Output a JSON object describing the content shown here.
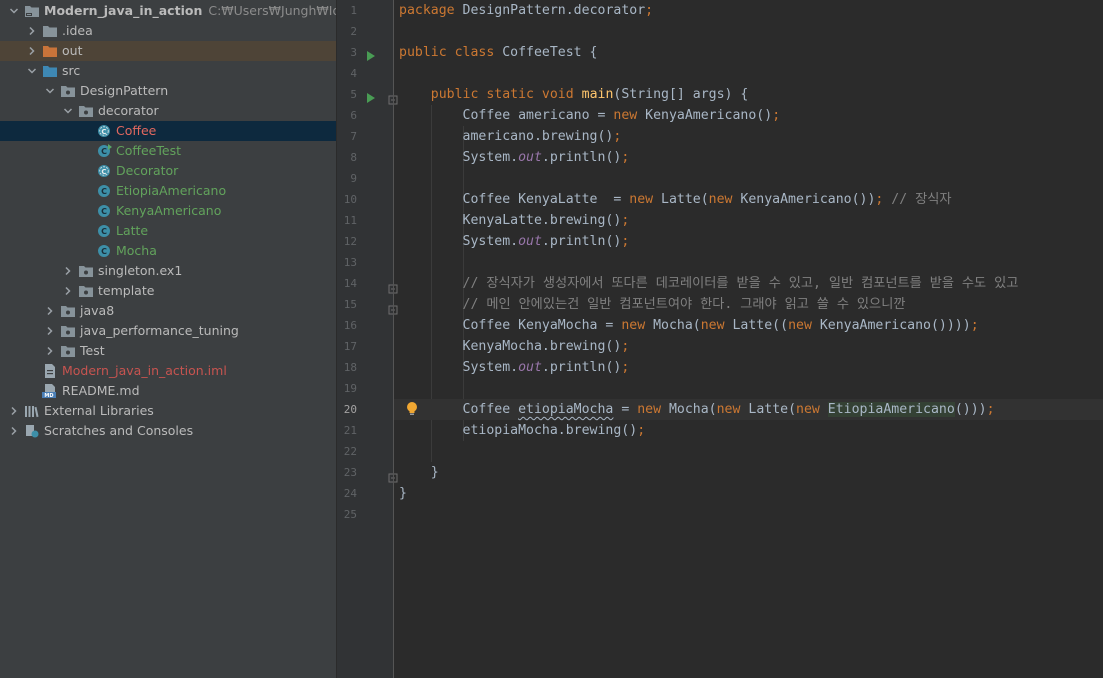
{
  "project": {
    "rows": [
      {
        "label": "Modern_java_in_action",
        "path": "C:₩Users₩Jungh₩IdeaProje",
        "icon": "project-folder-icon",
        "arrow": "down",
        "indent": 0,
        "style": "bold"
      },
      {
        "label": ".idea",
        "icon": "folder-icon",
        "arrow": "right",
        "indent": 1
      },
      {
        "label": "out",
        "icon": "orange-folder-icon",
        "arrow": "right",
        "indent": 1,
        "rowbg": "out"
      },
      {
        "label": "src",
        "icon": "source-folder-icon",
        "arrow": "down",
        "indent": 1
      },
      {
        "label": "DesignPattern",
        "icon": "package-icon",
        "arrow": "down",
        "indent": 2
      },
      {
        "label": "decorator",
        "icon": "package-icon",
        "arrow": "down",
        "indent": 3
      },
      {
        "label": "Coffee",
        "icon": "abstract-class-icon",
        "indent": 4,
        "color": "red2",
        "selected": true
      },
      {
        "label": "CoffeeTest",
        "icon": "runnable-class-icon",
        "indent": 4,
        "color": "green"
      },
      {
        "label": "Decorator",
        "icon": "abstract-class-icon",
        "indent": 4,
        "color": "green"
      },
      {
        "label": "EtiopiaAmericano",
        "icon": "class-icon",
        "indent": 4,
        "color": "green"
      },
      {
        "label": "KenyaAmericano",
        "icon": "class-icon",
        "indent": 4,
        "color": "green"
      },
      {
        "label": "Latte",
        "icon": "class-icon",
        "indent": 4,
        "color": "green"
      },
      {
        "label": "Mocha",
        "icon": "class-icon",
        "indent": 4,
        "color": "green"
      },
      {
        "label": "singleton.ex1",
        "icon": "package-icon",
        "arrow": "right",
        "indent": 3
      },
      {
        "label": "template",
        "icon": "package-icon",
        "arrow": "right",
        "indent": 3
      },
      {
        "label": "java8",
        "icon": "package-icon",
        "arrow": "right",
        "indent": 2
      },
      {
        "label": "java_performance_tuning",
        "icon": "package-icon",
        "arrow": "right",
        "indent": 2
      },
      {
        "label": "Test",
        "icon": "package-icon",
        "arrow": "right",
        "indent": 2
      },
      {
        "label": "Modern_java_in_action.iml",
        "icon": "iml-file-icon",
        "indent": 1,
        "color": "red"
      },
      {
        "label": "README.md",
        "icon": "markdown-file-icon",
        "indent": 1
      },
      {
        "label": "External Libraries",
        "icon": "library-icon",
        "arrow": "right",
        "indent": 0
      },
      {
        "label": "Scratches and Consoles",
        "icon": "scratches-icon",
        "arrow": "right",
        "indent": 0
      }
    ]
  },
  "editor": {
    "current_line": 20,
    "lines": [
      {
        "n": 1,
        "tokens": [
          [
            "kw",
            "package "
          ],
          [
            "",
            "DesignPattern.decorator"
          ],
          [
            "kw",
            ";"
          ]
        ]
      },
      {
        "n": 2,
        "tokens": []
      },
      {
        "n": 3,
        "run": true,
        "tokens": [
          [
            "kw",
            "public class "
          ],
          [
            "",
            "CoffeeTest {"
          ]
        ]
      },
      {
        "n": 4,
        "tokens": []
      },
      {
        "n": 5,
        "run": true,
        "fold": true,
        "tokens": [
          [
            "",
            "    "
          ],
          [
            "kw",
            "public static void "
          ],
          [
            "fn",
            "main"
          ],
          [
            "",
            "(String[] args) {"
          ]
        ]
      },
      {
        "n": 6,
        "tokens": [
          [
            "",
            "        Coffee americano = "
          ],
          [
            "kw",
            "new "
          ],
          [
            "",
            "KenyaAmericano()"
          ],
          [
            "kw",
            ";"
          ]
        ]
      },
      {
        "n": 7,
        "tokens": [
          [
            "",
            "        americano.brewing()"
          ],
          [
            "kw",
            ";"
          ]
        ]
      },
      {
        "n": 8,
        "tokens": [
          [
            "",
            "        System."
          ],
          [
            "st",
            "out"
          ],
          [
            "",
            ".println()"
          ],
          [
            "kw",
            ";"
          ]
        ]
      },
      {
        "n": 9,
        "tokens": []
      },
      {
        "n": 10,
        "tokens": [
          [
            "",
            "        Coffee KenyaLatte  = "
          ],
          [
            "kw",
            "new "
          ],
          [
            "",
            "Latte("
          ],
          [
            "kw",
            "new "
          ],
          [
            "",
            "KenyaAmericano())"
          ],
          [
            "kw",
            "; "
          ],
          [
            "cm",
            "// 장식자"
          ]
        ]
      },
      {
        "n": 11,
        "tokens": [
          [
            "",
            "        KenyaLatte.brewing()"
          ],
          [
            "kw",
            ";"
          ]
        ]
      },
      {
        "n": 12,
        "tokens": [
          [
            "",
            "        System."
          ],
          [
            "st",
            "out"
          ],
          [
            "",
            ".println()"
          ],
          [
            "kw",
            ";"
          ]
        ]
      },
      {
        "n": 13,
        "tokens": []
      },
      {
        "n": 14,
        "fold": true,
        "tokens": [
          [
            "",
            "        "
          ],
          [
            "cm",
            "// 장식자가 생성자에서 또다른 데코레이터를 받을 수 있고, 일반 컴포넌트를 받을 수도 있고"
          ]
        ]
      },
      {
        "n": 15,
        "fold": true,
        "tokens": [
          [
            "",
            "        "
          ],
          [
            "cm",
            "// 메인 안에있는건 일반 컴포넌트여야 한다. 그래야 읽고 쓸 수 있으니깐"
          ]
        ]
      },
      {
        "n": 16,
        "tokens": [
          [
            "",
            "        Coffee KenyaMocha = "
          ],
          [
            "kw",
            "new "
          ],
          [
            "",
            "Mocha("
          ],
          [
            "kw",
            "new "
          ],
          [
            "",
            "Latte(("
          ],
          [
            "kw",
            "new "
          ],
          [
            "",
            "KenyaAmericano())))"
          ],
          [
            "kw",
            ";"
          ]
        ]
      },
      {
        "n": 17,
        "tokens": [
          [
            "",
            "        KenyaMocha.brewing()"
          ],
          [
            "kw",
            ";"
          ]
        ]
      },
      {
        "n": 18,
        "tokens": [
          [
            "",
            "        System."
          ],
          [
            "st",
            "out"
          ],
          [
            "",
            ".println()"
          ],
          [
            "kw",
            ";"
          ]
        ]
      },
      {
        "n": 19,
        "tokens": []
      },
      {
        "n": 20,
        "bulb": true,
        "tokens": [
          [
            "",
            "        Coffee "
          ],
          [
            "wavy",
            "etiopiaMocha"
          ],
          [
            "",
            " = "
          ],
          [
            "kw",
            "new "
          ],
          [
            "",
            "Mocha("
          ],
          [
            "kw",
            "new "
          ],
          [
            "",
            "Latte("
          ],
          [
            "kw",
            "new "
          ],
          [
            "hl",
            "EtiopiaAmericano"
          ],
          [
            "",
            "()))"
          ],
          [
            "kw",
            ";"
          ]
        ]
      },
      {
        "n": 21,
        "tokens": [
          [
            "",
            "        etiopiaMocha.brewing()"
          ],
          [
            "kw",
            ";"
          ]
        ]
      },
      {
        "n": 22,
        "tokens": []
      },
      {
        "n": 23,
        "fold": true,
        "tokens": [
          [
            "",
            "    }"
          ]
        ]
      },
      {
        "n": 24,
        "tokens": [
          [
            "",
            "}"
          ]
        ]
      },
      {
        "n": 25,
        "tokens": []
      }
    ]
  },
  "colors": {
    "keyword": "#cc7832",
    "function": "#ffc66d",
    "static_field": "#9876aa",
    "comment": "#808080",
    "text": "#a9b7c6",
    "editor_bg": "#2b2b2b",
    "panel_bg": "#3c3f41",
    "selection": "#0d293e"
  }
}
